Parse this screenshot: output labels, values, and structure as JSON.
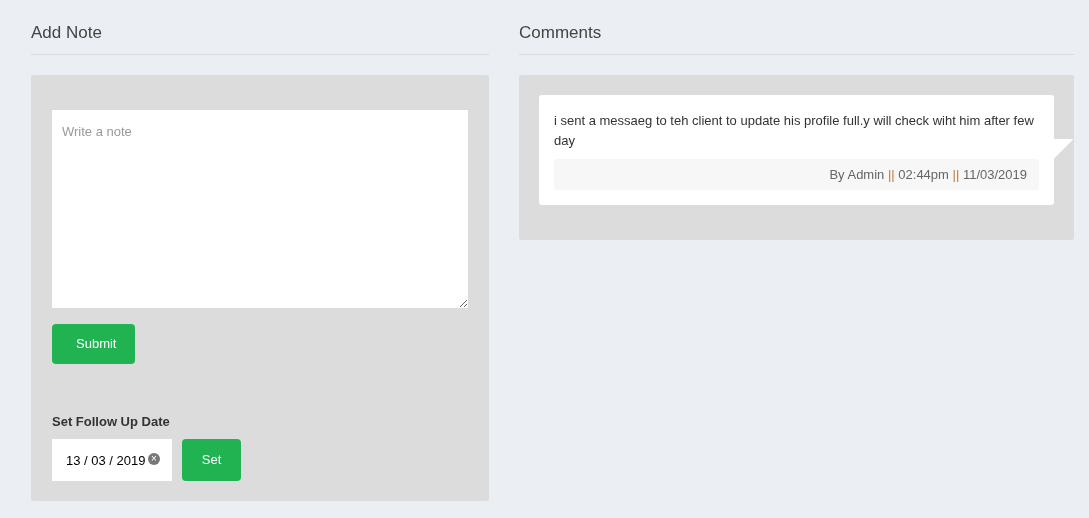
{
  "note": {
    "title": "Add Note",
    "placeholder": "Write a note",
    "submit": "Submit",
    "follow_up": {
      "label": "Set Follow Up Date",
      "value": "13 / 03 / 2019",
      "clear": "×",
      "button": "Set"
    }
  },
  "comments": {
    "title": "Comments",
    "items": [
      {
        "text": "i sent a messaeg to teh client to update his profile full.y will check wiht him after few day",
        "meta": [
          {
            "kind": "text",
            "text": "By Admin"
          },
          {
            "kind": "separator",
            "text": "||"
          },
          {
            "kind": "text",
            "text": "02:44pm"
          },
          {
            "kind": "separator",
            "text": "||"
          },
          {
            "kind": "text",
            "text": "11/03/2019"
          }
        ]
      }
    ]
  }
}
